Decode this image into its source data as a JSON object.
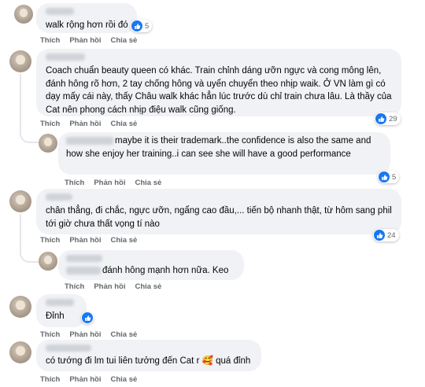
{
  "comments": [
    {
      "text": "walk rộng hơn rồi đó",
      "reactions": "5"
    },
    {
      "text": "Coach chuẩn beauty queen có khác. Train chỉnh dáng ưỡn ngực và cong mông lên, đánh hông rõ hơn, 2 tay chống hông và uyển chuyển theo nhịp waik. Ở VN làm gì có dạy mấy cái này, thấy Châu walk khác hẳn lúc trước dù chỉ train chưa lâu. Là thầy của Cat nên phong cách nhịp điệu walk cũng giống.",
      "reactions": "29"
    },
    {
      "text": "maybe it is their trademark..the confidence is also the same and how she enjoy her training..i can see she will have a good performance",
      "reactions": "5"
    },
    {
      "text": "chân thẳng, đi chắc, ngực ưỡn, ngẩng cao đầu,... tiến bộ nhanh thật, từ hôm sang phil tới giờ chưa thất vọng tí nào",
      "reactions": "24"
    },
    {
      "text": "đánh hông mạnh hơn nữa. Keo",
      "reactions": ""
    },
    {
      "text": "Đỉnh",
      "reactions": ""
    },
    {
      "text": "có tướng đi lm tui liên tưởng đến Cat r 🥰 quá đỉnh",
      "reactions": ""
    }
  ],
  "actions": {
    "like": "Thích",
    "reply": "Phản hồi",
    "share": "Chia sẻ"
  },
  "colors": {
    "bubble": "#f0f2f5",
    "like": "#1877f2",
    "meta": "#65676b"
  }
}
